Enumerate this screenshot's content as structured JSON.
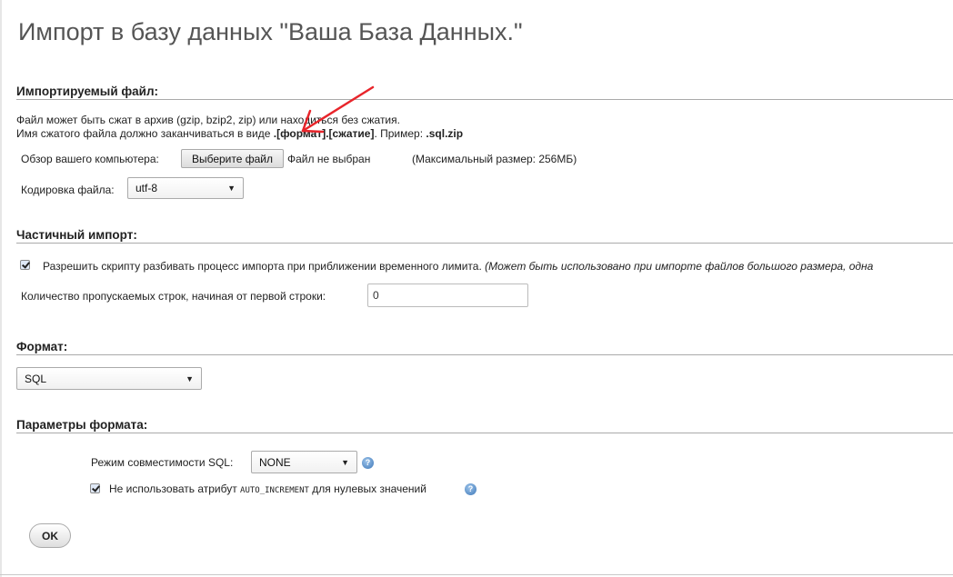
{
  "page_title": "Импорт в базу данных \"Ваша База Данных.\"",
  "import_file": {
    "section_title": "Импортируемый файл:",
    "info_line1": "Файл может быть сжат в архив (gzip, bzip2, zip) или находиться без сжатия.",
    "info_line2_prefix": "Имя сжатого файла должно заканчиваться в виде ",
    "info_line2_format": ".[формат].[сжатие]",
    "info_line2_middle": ". Пример: ",
    "info_line2_example": ".sql.zip",
    "browse_label": "Обзор вашего компьютера:",
    "choose_file_button": "Выберите файл",
    "no_file_text": "Файл не выбран",
    "max_size_text": "(Максимальный размер: 256МБ)",
    "encoding_label": "Кодировка файла:",
    "encoding_value": "utf-8"
  },
  "partial_import": {
    "section_title": "Частичный импорт:",
    "allow_interrupt_label": "Разрешить скрипту разбивать процесс импорта при приближении временного лимита.",
    "allow_interrupt_note": "(Может быть использовано при импорте файлов большого размера, одна",
    "allow_interrupt_checked": true,
    "skip_rows_label": "Количество пропускаемых строк, начиная от первой строки:",
    "skip_rows_value": "0"
  },
  "format": {
    "section_title": "Формат:",
    "value": "SQL"
  },
  "format_options": {
    "section_title": "Параметры формата:",
    "sql_compat_label": "Режим совместимости SQL:",
    "sql_compat_value": "NONE",
    "no_auto_increment_prefix": "Не использовать атрибут",
    "no_auto_increment_code": "AUTO_INCREMENT",
    "no_auto_increment_suffix": "для нулевых значений",
    "no_auto_increment_checked": true
  },
  "ok_button": "OK",
  "icons": {
    "help": "help-icon",
    "dropdown": "chevron-down-icon",
    "check": "checkmark-icon"
  },
  "colors": {
    "annotation_arrow": "#e8252b",
    "help_icon": "#3e78b8"
  }
}
